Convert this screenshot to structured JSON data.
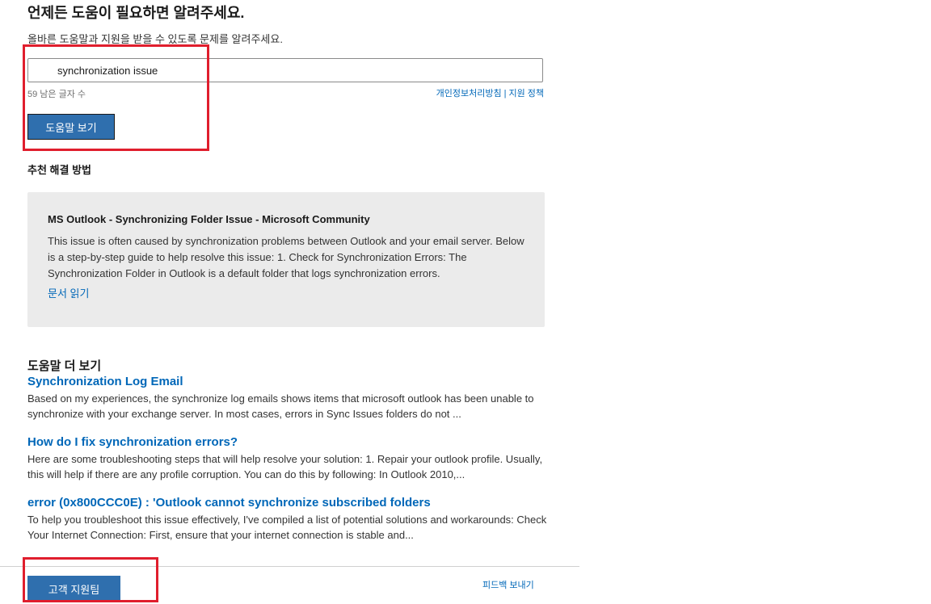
{
  "header": {
    "title": "언제든 도움이 필요하면 알려주세요.",
    "subtitle": "올바른 도움말과 지원을 받을 수 있도록 문제를 알려주세요."
  },
  "search": {
    "value": "synchronization issue",
    "char_count": "59 남은 글자 수",
    "privacy_link": "개인정보처리방침",
    "separator": "|",
    "support_policy_link": "지원 정책",
    "help_button": "도움말 보기"
  },
  "recommended": {
    "heading": "추천 해결 방법",
    "title": "MS Outlook - Synchronizing Folder Issue - Microsoft Community",
    "body": "This issue is often caused by synchronization problems between Outlook and your email server. Below is a step-by-step guide to help resolve this issue: 1. Check for Synchronization Errors: The Synchronization Folder in Outlook is a default folder that logs synchronization errors.",
    "read_link": "문서 읽기"
  },
  "more_help": {
    "heading": "도움말 더 보기",
    "articles": [
      {
        "title": "Synchronization Log Email",
        "snippet": "Based on my experiences, the synchronize log emails shows items that microsoft outlook has been unable to synchronize with your exchange server. In most cases, errors in Sync Issues folders do not ..."
      },
      {
        "title": "How do I fix synchronization errors?",
        "snippet": "Here are some troubleshooting steps that will help resolve your solution: 1. Repair your outlook profile. Usually, this will help if there are any profile corruption. You can do this by following: In Outlook 2010,..."
      },
      {
        "title": "error (0x800CCC0E) : 'Outlook cannot synchronize subscribed folders",
        "snippet": "To help you troubleshoot this issue effectively, I've compiled a list of potential solutions and workarounds: Check Your Internet Connection: First, ensure that your internet connection is stable and..."
      }
    ]
  },
  "footer": {
    "support_button": "고객 지원팀",
    "feedback_link": "피드백 보내기"
  },
  "colors": {
    "link": "#0067b8",
    "button": "#2f6fae",
    "card_bg": "#ebebeb",
    "annotation_red": "#e01e2d"
  }
}
